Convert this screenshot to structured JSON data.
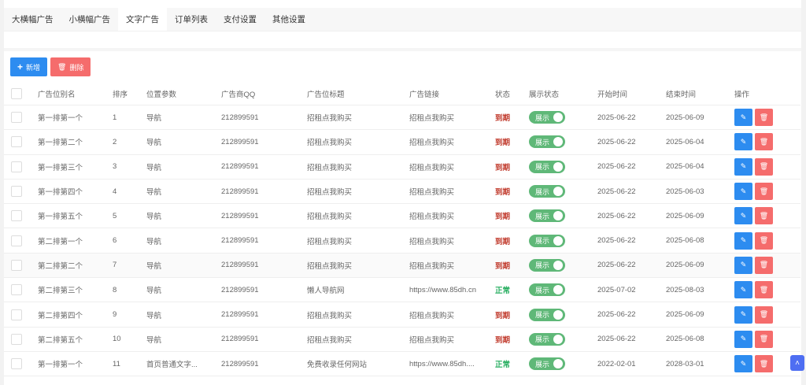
{
  "tabs": [
    {
      "label": "大横幅广告"
    },
    {
      "label": "小横幅广告"
    },
    {
      "label": "文字广告",
      "active": true
    },
    {
      "label": "订单列表"
    },
    {
      "label": "支付设置"
    },
    {
      "label": "其他设置"
    }
  ],
  "toolbar": {
    "add_label": "新增",
    "delete_label": "删除"
  },
  "colors": {
    "primary": "#2d8cf0",
    "danger": "#f56c6c",
    "toggle": "#5fb878",
    "expired": "#c0392b",
    "normal": "#27ae60"
  },
  "columns": [
    "广告位别名",
    "排序",
    "位置参数",
    "广告商QQ",
    "广告位标题",
    "广告链接",
    "状态",
    "展示状态",
    "开始时间",
    "结束时间",
    "操作"
  ],
  "rows": [
    {
      "name": "第一排第一个",
      "sort": "1",
      "pos": "导航",
      "qq": "212899591",
      "title": "招租点我购买",
      "link": "招租点我购买",
      "status": "到期",
      "show": "展示",
      "start": "2025-06-22",
      "end": "2025-06-09"
    },
    {
      "name": "第一排第二个",
      "sort": "2",
      "pos": "导航",
      "qq": "212899591",
      "title": "招租点我购买",
      "link": "招租点我购买",
      "status": "到期",
      "show": "展示",
      "start": "2025-06-22",
      "end": "2025-06-04"
    },
    {
      "name": "第一排第三个",
      "sort": "3",
      "pos": "导航",
      "qq": "212899591",
      "title": "招租点我购买",
      "link": "招租点我购买",
      "status": "到期",
      "show": "展示",
      "start": "2025-06-22",
      "end": "2025-06-04"
    },
    {
      "name": "第一排第四个",
      "sort": "4",
      "pos": "导航",
      "qq": "212899591",
      "title": "招租点我购买",
      "link": "招租点我购买",
      "status": "到期",
      "show": "展示",
      "start": "2025-06-22",
      "end": "2025-06-03"
    },
    {
      "name": "第一排第五个",
      "sort": "5",
      "pos": "导航",
      "qq": "212899591",
      "title": "招租点我购买",
      "link": "招租点我购买",
      "status": "到期",
      "show": "展示",
      "start": "2025-06-22",
      "end": "2025-06-09"
    },
    {
      "name": "第二排第一个",
      "sort": "6",
      "pos": "导航",
      "qq": "212899591",
      "title": "招租点我购买",
      "link": "招租点我购买",
      "status": "到期",
      "show": "展示",
      "start": "2025-06-22",
      "end": "2025-06-08"
    },
    {
      "name": "第二排第二个",
      "sort": "7",
      "pos": "导航",
      "qq": "212899591",
      "title": "招租点我购买",
      "link": "招租点我购买",
      "status": "到期",
      "show": "展示",
      "start": "2025-06-22",
      "end": "2025-06-09"
    },
    {
      "name": "第二排第三个",
      "sort": "8",
      "pos": "导航",
      "qq": "212899591",
      "title": "懒人导航网",
      "link": "https://www.85dh.cn",
      "status": "正常",
      "show": "展示",
      "start": "2025-07-02",
      "end": "2025-08-03"
    },
    {
      "name": "第二排第四个",
      "sort": "9",
      "pos": "导航",
      "qq": "212899591",
      "title": "招租点我购买",
      "link": "招租点我购买",
      "status": "到期",
      "show": "展示",
      "start": "2025-06-22",
      "end": "2025-06-09"
    },
    {
      "name": "第二排第五个",
      "sort": "10",
      "pos": "导航",
      "qq": "212899591",
      "title": "招租点我购买",
      "link": "招租点我购买",
      "status": "到期",
      "show": "展示",
      "start": "2025-06-22",
      "end": "2025-06-08"
    },
    {
      "name": "第一排第一个",
      "sort": "11",
      "pos": "首页普通文字...",
      "qq": "212899591",
      "title": "免费收录任何网站",
      "link": "https://www.85dh....",
      "status": "正常",
      "show": "展示",
      "start": "2022-02-01",
      "end": "2028-03-01"
    }
  ]
}
